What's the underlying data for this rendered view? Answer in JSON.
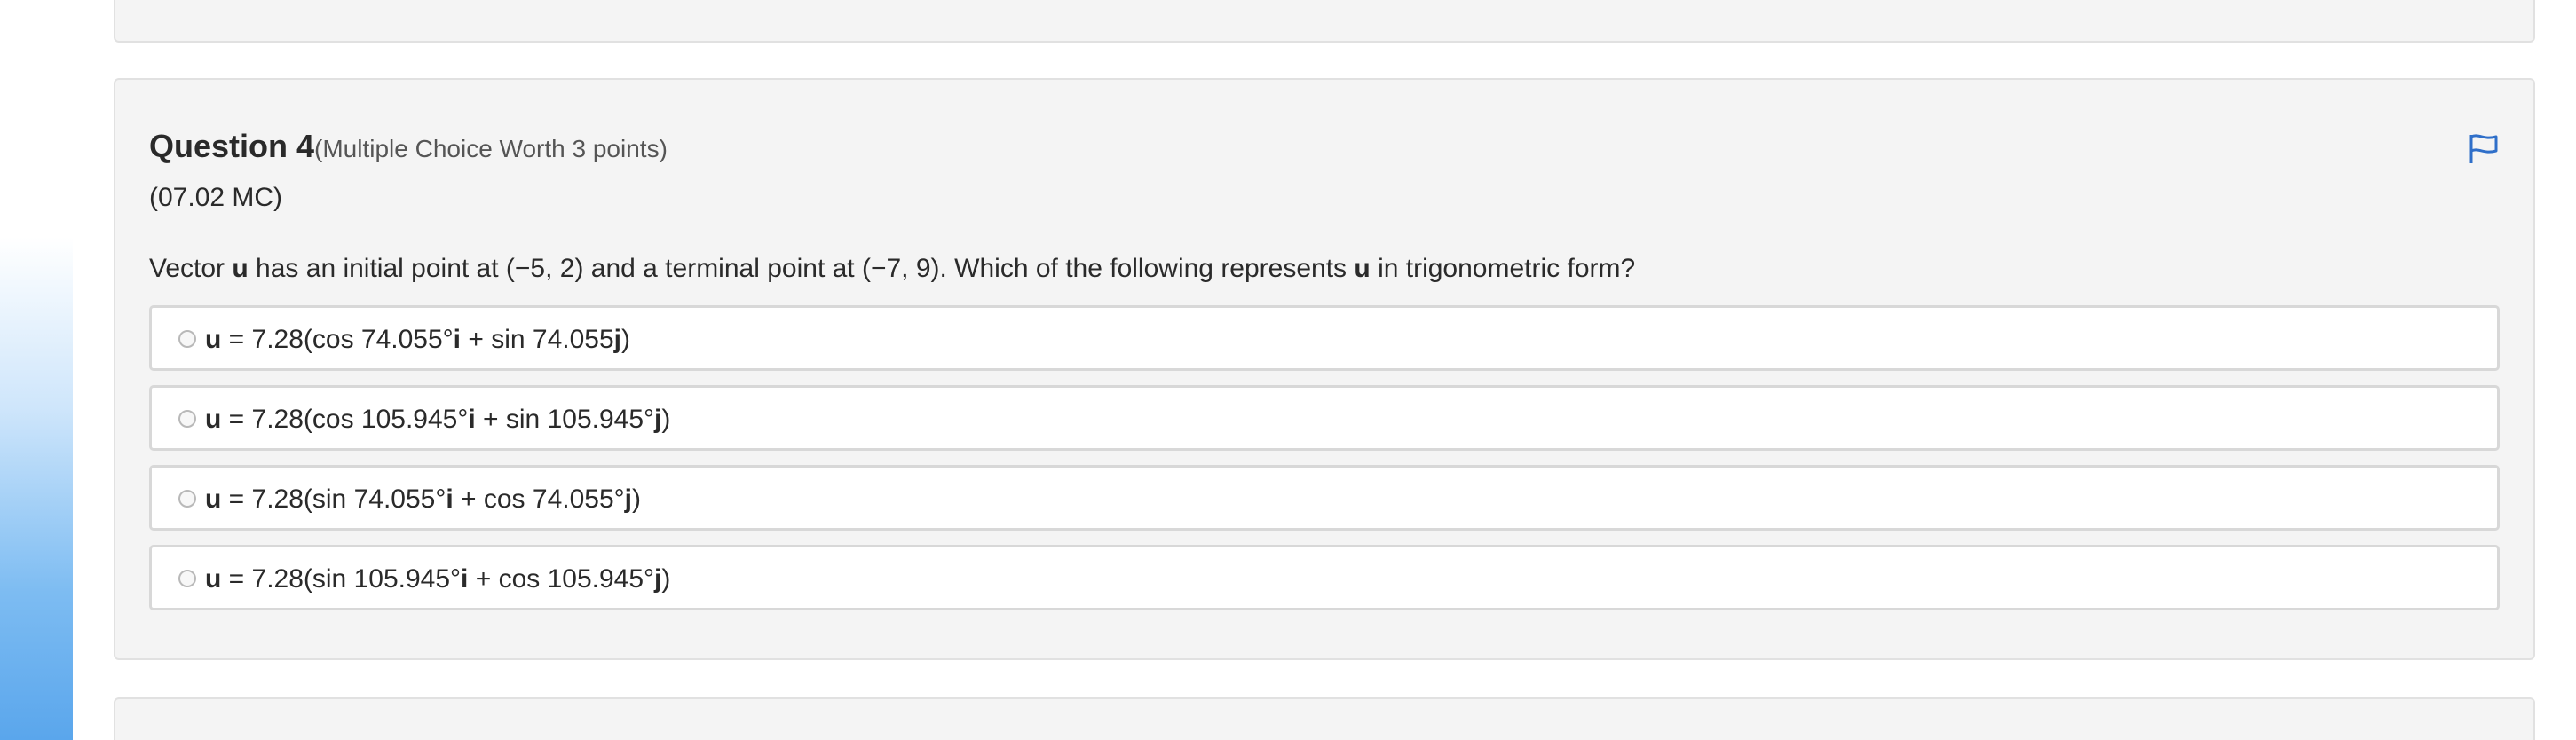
{
  "question": {
    "title": "Question 4",
    "worth": "(Multiple Choice Worth 3 points)",
    "code": "(07.02 MC)",
    "text": {
      "p1": "Vector ",
      "u1": "u",
      "p2": " has an initial point at (−5, 2) and a terminal point at (−7, 9). Which of the following represents ",
      "u2": "u",
      "p3": " in trigonometric form?"
    },
    "flag_icon": "flag-icon",
    "accent_color": "#2f6fc9"
  },
  "options": [
    {
      "v": "u",
      "a": " = 7.28(cos 74.055°",
      "i": "i",
      "b": " + sin 74.055",
      "j": "j",
      "c": ")"
    },
    {
      "v": "u",
      "a": " = 7.28(cos 105.945°",
      "i": "i",
      "b": " + sin 105.945°",
      "j": "j",
      "c": ")"
    },
    {
      "v": "u",
      "a": " = 7.28(sin 74.055°",
      "i": "i",
      "b": " + cos 74.055°",
      "j": "j",
      "c": ")"
    },
    {
      "v": "u",
      "a": " = 7.28(sin 105.945°",
      "i": "i",
      "b": " + cos 105.945°",
      "j": "j",
      "c": ")"
    }
  ]
}
